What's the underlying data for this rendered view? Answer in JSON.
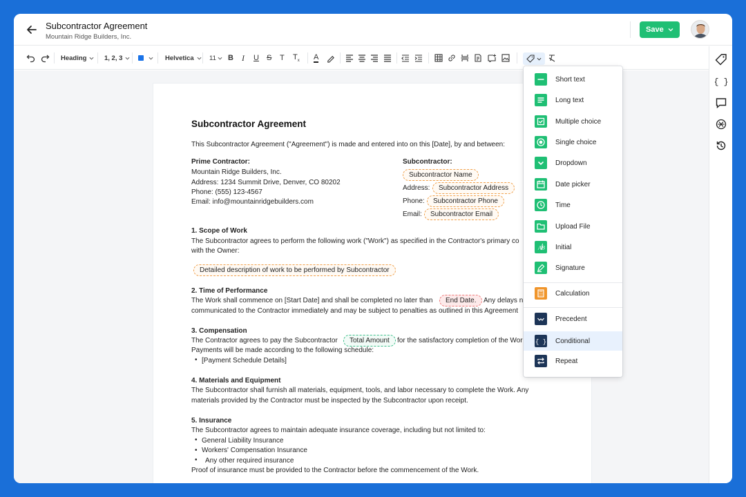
{
  "header": {
    "title": "Subcontractor Agreement",
    "subtitle": "Mountain Ridge Builders, Inc.",
    "save_label": "Save"
  },
  "toolbar": {
    "style_label": "Heading",
    "list_label": "1, 2, 3",
    "text_color": "#1a73e8",
    "font_label": "Helvetica",
    "size_label": "11"
  },
  "colors": {
    "accent": "#1fbf74",
    "menu_field": "#1fbf74",
    "menu_calc": "#f0952b",
    "menu_logic": "#1d3557",
    "highlight": "#e8f1fd"
  },
  "document": {
    "title": "Subcontractor Agreement",
    "intro": "This Subcontractor Agreement (\"Agreement\") is made and entered into on this [Date], by and between:",
    "prime": {
      "heading": "Prime Contractor:",
      "name": "Mountain Ridge Builders, Inc.",
      "address": "Address: 1234 Summit Drive, Denver, CO 80202",
      "phone": "Phone: (555) 123-4567",
      "email": "Email: info@mountainridgebuilders.com"
    },
    "sub": {
      "heading": "Subcontractor:",
      "name_field": "Subcontractor Name",
      "address_label": "Address:",
      "address_field": "Subcontractor Address",
      "phone_label": "Phone:",
      "phone_field": "Subcontractor Phone",
      "email_label": "Email:",
      "email_field": "Subcontractor Email"
    },
    "s1": {
      "heading": "1. Scope of Work",
      "line1": "The Subcontractor agrees to perform the following work (\"Work\") as specified in the Contractor's primary co",
      "line2": "with the Owner:",
      "field": "Detailed description of work to be performed by Subcontractor"
    },
    "s2": {
      "heading": "2. Time of Performance",
      "line1a": "The Work shall commence on [Start Date] and shall be completed no later than",
      "field": "End Date.",
      "line1b": "Any delays n",
      "line2": "communicated to the Contractor immediately and may be subject to penalties as outlined in this Agreement"
    },
    "s3": {
      "heading": "3. Compensation",
      "line1a": "The Contractor agrees to pay the Subcontractor",
      "field": "Total Amount",
      "line1b": "for the satisfactory completion of the Wor",
      "line2": "Payments will be made according to the following schedule:",
      "bullet1": "[Payment Schedule Details]"
    },
    "s4": {
      "heading": "4. Materials and Equipment",
      "line1": "The Subcontractor shall furnish all materials, equipment, tools, and labor necessary to complete the Work. Any",
      "line2": "materials provided by the Contractor must be inspected by the Subcontractor upon receipt."
    },
    "s5": {
      "heading": "5. Insurance",
      "line1": "The Subcontractor agrees to maintain adequate insurance coverage, including but not limited to:",
      "bullets": [
        "General Liability Insurance",
        "Workers' Compensation Insurance",
        "Any other required insurance"
      ],
      "line2": "Proof of insurance must be provided to the Contractor before the commencement of the Work."
    }
  },
  "menu": {
    "items": [
      {
        "label": "Short text",
        "icon": "short-text-icon"
      },
      {
        "label": "Long text",
        "icon": "long-text-icon"
      },
      {
        "label": "Multiple choice",
        "icon": "checkbox-icon"
      },
      {
        "label": "Single choice",
        "icon": "radio-icon"
      },
      {
        "label": "Dropdown",
        "icon": "chevron-down-icon"
      },
      {
        "label": "Date picker",
        "icon": "calendar-icon"
      },
      {
        "label": "Time",
        "icon": "clock-icon"
      },
      {
        "label": "Upload File",
        "icon": "folder-icon"
      },
      {
        "label": "Initial",
        "icon": "initial-icon"
      },
      {
        "label": "Signature",
        "icon": "pen-icon"
      },
      {
        "label": "Calculation",
        "icon": "calculator-icon"
      },
      {
        "label": "Precedent",
        "icon": "precedent-icon"
      },
      {
        "label": "Conditional",
        "icon": "braces-icon"
      },
      {
        "label": "Repeat",
        "icon": "repeat-icon"
      }
    ]
  }
}
